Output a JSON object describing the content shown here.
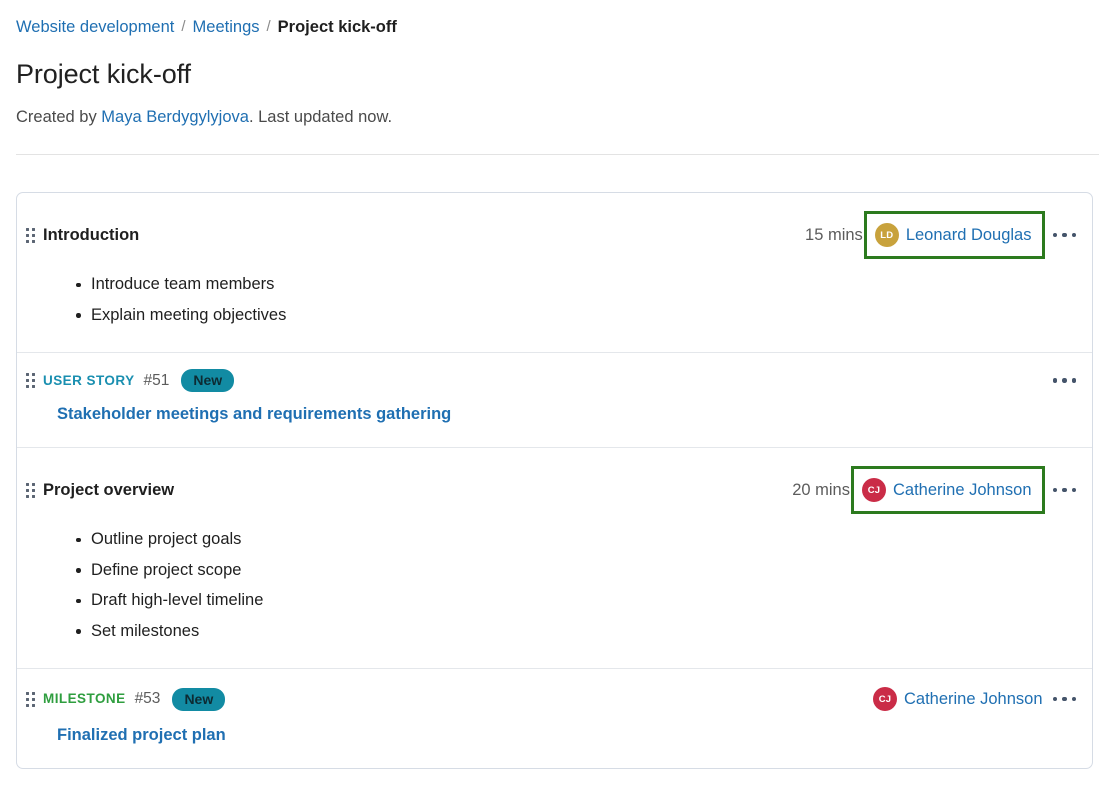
{
  "breadcrumb": {
    "items": [
      {
        "label": "Website development",
        "current": false
      },
      {
        "label": "Meetings",
        "current": false
      },
      {
        "label": "Project kick-off",
        "current": true
      }
    ],
    "separator": "/"
  },
  "header": {
    "title": "Project kick-off",
    "created_prefix": "Created by ",
    "author": "Maya Berdygylyjova",
    "updated_suffix": ". Last updated now."
  },
  "colors": {
    "link": "#1f6fb2",
    "highlight_box": "#2c7a1e",
    "badge_new_bg": "#128ba3",
    "user_story": "#1a8fb0",
    "milestone": "#2f9e3f",
    "avatar_ld": "#c8a23c",
    "avatar_cj": "#ca2c47"
  },
  "agenda": [
    {
      "kind": "section",
      "drag_icon": "drag-handle-icon",
      "title": "Introduction",
      "duration": "15 mins",
      "owner": {
        "initials": "LD",
        "name": "Leonard Douglas",
        "avatar_color": "#c8a23c",
        "highlighted": true
      },
      "menu_icon": "ellipsis-icon",
      "bullets": [
        "Introduce team members",
        "Explain meeting objectives"
      ]
    },
    {
      "kind": "workitem",
      "drag_icon": "drag-handle-icon",
      "type": "USER STORY",
      "type_class": "userstory",
      "id": "#51",
      "state": "New",
      "title": "Stakeholder meetings and requirements gathering",
      "menu_icon": "ellipsis-icon"
    },
    {
      "kind": "section",
      "drag_icon": "drag-handle-icon",
      "title": "Project overview",
      "duration": "20 mins",
      "owner": {
        "initials": "CJ",
        "name": "Catherine Johnson",
        "avatar_color": "#ca2c47",
        "highlighted": true
      },
      "menu_icon": "ellipsis-icon",
      "bullets": [
        "Outline project goals",
        "Define project scope",
        "Draft high-level timeline",
        "Set milestones"
      ]
    },
    {
      "kind": "workitem",
      "drag_icon": "drag-handle-icon",
      "type": "MILESTONE",
      "type_class": "milestone",
      "id": "#53",
      "state": "New",
      "title": "Finalized project plan",
      "menu_icon": "ellipsis-icon",
      "owner": {
        "initials": "CJ",
        "name": "Catherine Johnson",
        "avatar_color": "#ca2c47",
        "highlighted": false
      }
    }
  ]
}
